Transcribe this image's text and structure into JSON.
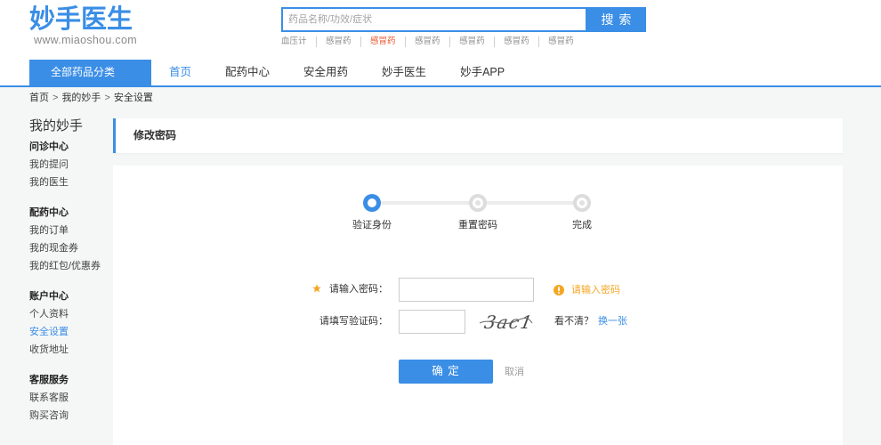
{
  "colors": {
    "brand": "#3a8ee6",
    "warning": "#f5a623",
    "hot": "#e8542b",
    "page_bg": "#f5f6f6"
  },
  "header": {
    "logo_text": "妙手医生",
    "logo_url_text": "www.miaoshou.com"
  },
  "search": {
    "placeholder": "药品名称/功效/症状",
    "value": "",
    "button_label": "搜 索",
    "hot_keywords": [
      {
        "label": "血压计",
        "highlight": false
      },
      {
        "label": "感冒药",
        "highlight": false
      },
      {
        "label": "感冒药",
        "highlight": true
      },
      {
        "label": "感冒药",
        "highlight": false
      },
      {
        "label": "感冒药",
        "highlight": false
      },
      {
        "label": "感冒药",
        "highlight": false
      },
      {
        "label": "感冒药",
        "highlight": false
      }
    ]
  },
  "nav": {
    "category_label": "全部药品分类",
    "items": [
      {
        "label": "首页",
        "active": true
      },
      {
        "label": "配药中心",
        "active": false
      },
      {
        "label": "安全用药",
        "active": false
      },
      {
        "label": "妙手医生",
        "active": false
      },
      {
        "label": "妙手APP",
        "active": false
      }
    ]
  },
  "breadcrumb": {
    "separator": ">",
    "items": [
      {
        "label": "首页"
      },
      {
        "label": "我的妙手"
      },
      {
        "label": "安全设置"
      }
    ]
  },
  "sidebar": {
    "title": "我的妙手",
    "groups": [
      {
        "title": "问诊中心",
        "items": [
          {
            "label": "我的提问",
            "active": false
          },
          {
            "label": "我的医生",
            "active": false
          }
        ]
      },
      {
        "title": "配药中心",
        "items": [
          {
            "label": "我的订单",
            "active": false
          },
          {
            "label": "我的现金券",
            "active": false
          },
          {
            "label": "我的红包/优惠券",
            "active": false
          }
        ]
      },
      {
        "title": "账户中心",
        "items": [
          {
            "label": "个人资料",
            "active": false
          },
          {
            "label": "安全设置",
            "active": true
          },
          {
            "label": "收货地址",
            "active": false
          }
        ]
      },
      {
        "title": "客服服务",
        "items": [
          {
            "label": "联系客服",
            "active": false
          },
          {
            "label": "购买咨询",
            "active": false
          }
        ]
      }
    ]
  },
  "content": {
    "page_title": "修改密码",
    "steps": [
      {
        "label": "验证身份",
        "active": true
      },
      {
        "label": "重置密码",
        "active": false
      },
      {
        "label": "完成",
        "active": false
      }
    ],
    "form": {
      "password": {
        "label": "请输入密码：",
        "required": true,
        "required_icon": "star-icon",
        "value": "",
        "hint": "请输入密码",
        "hint_icon": "warning-icon"
      },
      "captcha": {
        "label": "请填写验证码：",
        "value": "",
        "image_text": "3ac1",
        "unclear_text": "看不清？",
        "refresh_label": "换一张"
      },
      "submit_label": "确 定",
      "cancel_label": "取消"
    }
  }
}
